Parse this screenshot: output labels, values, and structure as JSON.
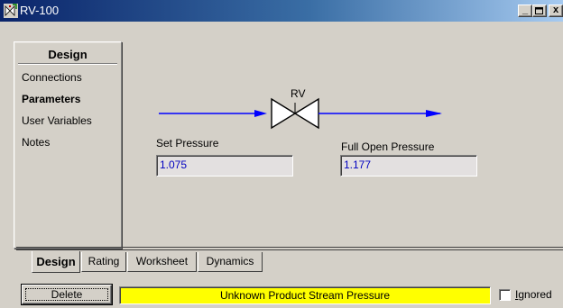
{
  "window": {
    "title": "RV-100",
    "controls": {
      "minimize": "_",
      "maximize": "□",
      "close": "x"
    }
  },
  "nav": {
    "header": "Design",
    "items": [
      {
        "label": "Connections",
        "active": false
      },
      {
        "label": "Parameters",
        "active": true
      },
      {
        "label": "User Variables",
        "active": false
      },
      {
        "label": "Notes",
        "active": false
      }
    ]
  },
  "diagram": {
    "valve_label": "RV",
    "stream_color": "#0000ff"
  },
  "fields": {
    "set_pressure": {
      "label": "Set Pressure",
      "value": "1.075"
    },
    "full_open_pressure": {
      "label": "Full Open Pressure",
      "value": "1.177"
    }
  },
  "tabs": [
    {
      "label": "Design",
      "active": true
    },
    {
      "label": "Rating",
      "active": false
    },
    {
      "label": "Worksheet",
      "active": false
    },
    {
      "label": "Dynamics",
      "active": false
    }
  ],
  "footer": {
    "delete_label": "Delete",
    "status_text": "Unknown Product Stream Pressure",
    "status_color": "#ffff00",
    "ignored_label_underlined": "I",
    "ignored_label_rest": "gnored",
    "ignored_checked": false
  },
  "icons": {
    "title_icon": "relief-valve-icon"
  }
}
